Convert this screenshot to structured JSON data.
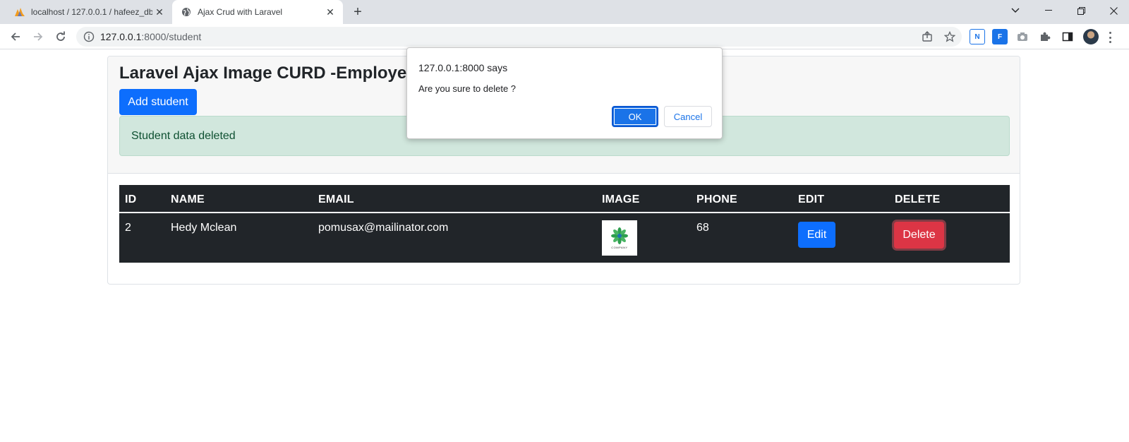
{
  "browser": {
    "tabs": [
      {
        "title": "localhost / 127.0.0.1 / hafeez_db |",
        "icon": "phpmyadmin-icon",
        "active": false
      },
      {
        "title": "Ajax Crud with Laravel",
        "icon": "globe-icon",
        "active": true
      }
    ],
    "url_host": "127.0.0.1",
    "url_rest": ":8000/student"
  },
  "page": {
    "title": "Laravel Ajax Image CURD -Employee",
    "add_button": "Add student",
    "alert_text": "Student data deleted",
    "alert_color": "#d1e7dd"
  },
  "table": {
    "headers": [
      "ID",
      "NAME",
      "EMAIL",
      "IMAGE",
      "PHONE",
      "EDIT",
      "DELETE"
    ],
    "rows": [
      {
        "id": "2",
        "name": "Hedy Mclean",
        "email": "pomusax@mailinator.com",
        "image_caption": "COMPANY",
        "phone": "68",
        "edit_label": "Edit",
        "delete_label": "Delete"
      }
    ]
  },
  "dialog": {
    "title": "127.0.0.1:8000 says",
    "message": "Are you sure to delete ?",
    "ok_label": "OK",
    "cancel_label": "Cancel"
  },
  "colors": {
    "primary": "#0d6efd",
    "danger": "#dc3545",
    "table_dark": "#212529",
    "alert_text": "#0f5132"
  }
}
